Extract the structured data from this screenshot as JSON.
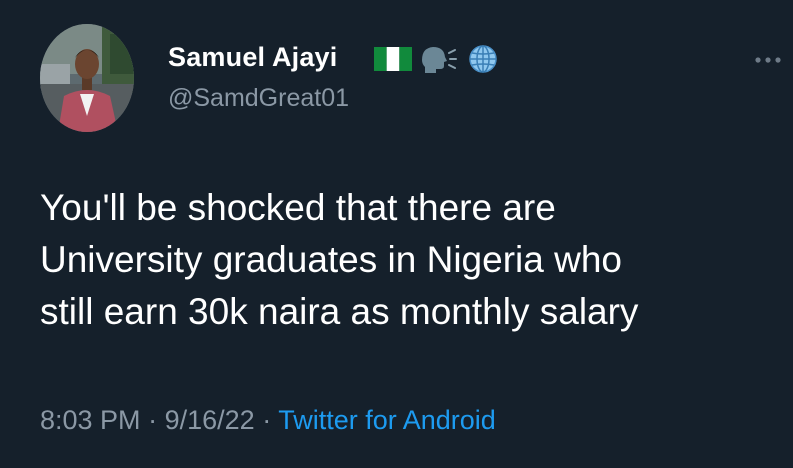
{
  "tweet": {
    "author": {
      "display_name": "Samuel Ajayi",
      "handle": "@SamdGreat01",
      "avatar_icon": "profile-photo",
      "name_emojis": [
        "nigeria-flag-icon",
        "speaking-head-icon",
        "globe-icon"
      ]
    },
    "text": "You'll be shocked that there are\nUniversity graduates in Nigeria who\nstill earn 30k naira as monthly salary",
    "time": "8:03 PM",
    "separator_1": "·",
    "date": "9/16/22",
    "separator_2": "·",
    "source": "Twitter for Android",
    "menu_icon": "more-options-icon"
  },
  "colors": {
    "background": "#15202b",
    "primary_text": "#ffffff",
    "secondary_text": "#8b98a5",
    "link": "#1d9bf0"
  }
}
